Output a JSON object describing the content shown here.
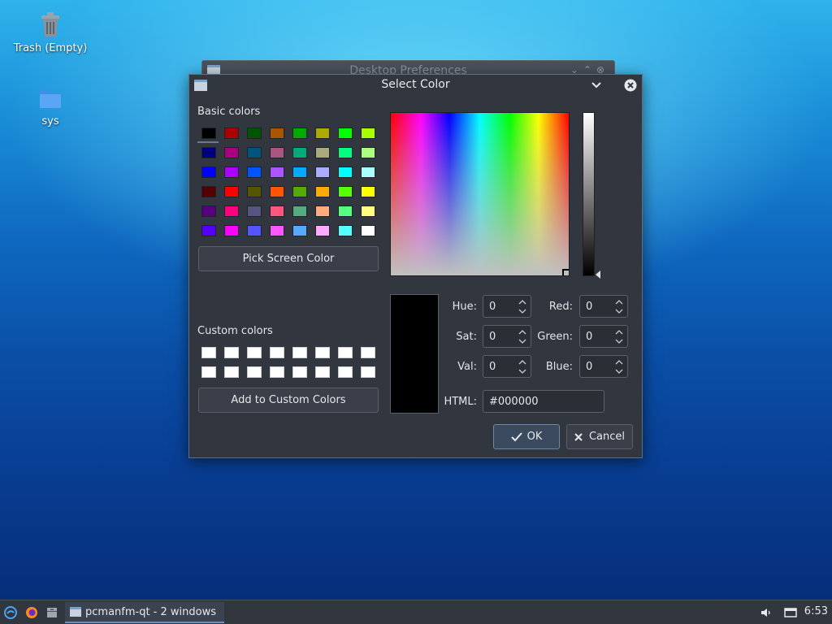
{
  "desktop": {
    "icons": [
      {
        "label": "Trash (Empty)",
        "icon": "trash-icon"
      },
      {
        "label": "sys",
        "icon": "folder-icon"
      }
    ]
  },
  "background_window": {
    "title": "Desktop Preferences"
  },
  "dialog": {
    "title": "Select Color",
    "basic_colors_label": "Basic colors",
    "basic_colors": [
      "#000000",
      "#aa0000",
      "#005500",
      "#aa5500",
      "#00aa00",
      "#aaaa00",
      "#00ff00",
      "#aaff00",
      "#00007f",
      "#aa007f",
      "#00557f",
      "#aa557f",
      "#00aa7f",
      "#aaaa7f",
      "#00ff7f",
      "#aaff7f",
      "#0000ff",
      "#aa00ff",
      "#0055ff",
      "#aa55ff",
      "#00aaff",
      "#aaaaff",
      "#00ffff",
      "#aaffff",
      "#550000",
      "#ff0000",
      "#555500",
      "#ff5500",
      "#55aa00",
      "#ffaa00",
      "#55ff00",
      "#ffff00",
      "#55007f",
      "#ff007f",
      "#55557f",
      "#ff557f",
      "#55aa7f",
      "#ffaa7f",
      "#55ff7f",
      "#ffff7f",
      "#5500ff",
      "#ff00ff",
      "#5555ff",
      "#ff55ff",
      "#55aaff",
      "#ffaaff",
      "#55ffff",
      "#ffffff"
    ],
    "selected_basic_index": 0,
    "pick_screen_color_label": "Pick Screen Color",
    "custom_colors_label": "Custom colors",
    "custom_colors": [
      "#ffffff",
      "#ffffff",
      "#ffffff",
      "#ffffff",
      "#ffffff",
      "#ffffff",
      "#ffffff",
      "#ffffff",
      "#ffffff",
      "#ffffff",
      "#ffffff",
      "#ffffff",
      "#ffffff",
      "#ffffff",
      "#ffffff",
      "#ffffff"
    ],
    "add_custom_label": "Add to Custom Colors",
    "fields": {
      "hue": {
        "label": "Hue:",
        "value": "0"
      },
      "sat": {
        "label": "Sat:",
        "value": "0"
      },
      "val": {
        "label": "Val:",
        "value": "0"
      },
      "red": {
        "label": "Red:",
        "value": "0"
      },
      "green": {
        "label": "Green:",
        "value": "0"
      },
      "blue": {
        "label": "Blue:",
        "value": "0"
      }
    },
    "html_label": "HTML:",
    "html_value": "#000000",
    "preview_color": "#000000",
    "ok_label": "OK",
    "cancel_label": "Cancel"
  },
  "taskbar": {
    "task_label": "pcmanfm-qt - 2 windows",
    "clock": "6:53"
  }
}
